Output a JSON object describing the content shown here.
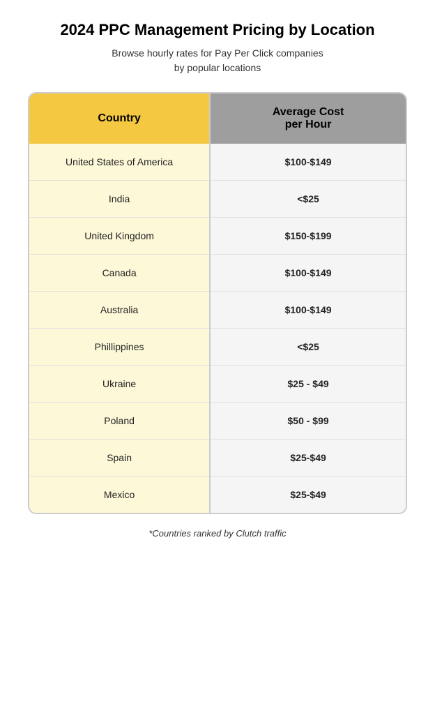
{
  "title": "2024 PPC Management Pricing by Location",
  "subtitle": "Browse hourly rates for Pay Per Click companies\nby popular locations",
  "table": {
    "header": {
      "country": "Country",
      "cost": "Average Cost\nper Hour"
    },
    "rows": [
      {
        "country": "United States of America",
        "cost": "$100-$149"
      },
      {
        "country": "India",
        "cost": "<$25"
      },
      {
        "country": "United Kingdom",
        "cost": "$150-$199"
      },
      {
        "country": "Canada",
        "cost": "$100-$149"
      },
      {
        "country": "Australia",
        "cost": "$100-$149"
      },
      {
        "country": "Phillippines",
        "cost": "<$25"
      },
      {
        "country": "Ukraine",
        "cost": "$25 - $49"
      },
      {
        "country": "Poland",
        "cost": "$50 - $99"
      },
      {
        "country": "Spain",
        "cost": "$25-$49"
      },
      {
        "country": "Mexico",
        "cost": "$25-$49"
      }
    ]
  },
  "footer": "*Countries ranked by Clutch traffic"
}
